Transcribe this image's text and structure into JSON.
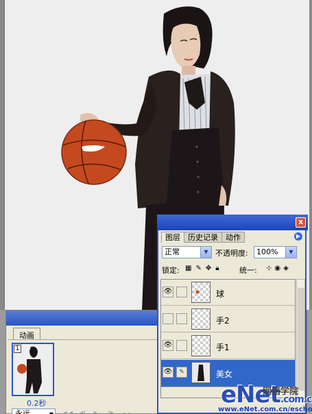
{
  "canvas": {
    "description_icon": "photo-canvas"
  },
  "animation_panel": {
    "tab_label": "动画",
    "frame_number": "1",
    "frame_delay": "0.2秒",
    "loop_value": "永远",
    "transport_icons": [
      "first-frame-icon",
      "prev-frame-icon",
      "play-icon",
      "next-frame-icon",
      "tween-icon"
    ]
  },
  "layers_panel": {
    "close_label": "x",
    "tabs": [
      {
        "label": "图层",
        "active": true
      },
      {
        "label": "历史记录",
        "active": false
      },
      {
        "label": "动作",
        "active": false
      }
    ],
    "blend_mode": "正常",
    "opacity_label": "不透明度:",
    "opacity_value": "100%",
    "lock_label": "锁定:",
    "unify_label": "统一:",
    "layers": [
      {
        "name": "球",
        "visible": true,
        "selected": false
      },
      {
        "name": "手2",
        "visible": false,
        "selected": false
      },
      {
        "name": "手1",
        "visible": true,
        "selected": false
      },
      {
        "name": "美女",
        "visible": true,
        "selected": true
      }
    ]
  },
  "watermark": {
    "logo": "eNet",
    "suffix": ".com.cn",
    "chinese": "网络学院",
    "url": "www.eNet.com.cn/eschool"
  },
  "colors": {
    "title_blue": "#2b55c7",
    "panel_bg": "#ece9d8",
    "selected_row": "#3167c9",
    "close_button": "#d65735"
  }
}
